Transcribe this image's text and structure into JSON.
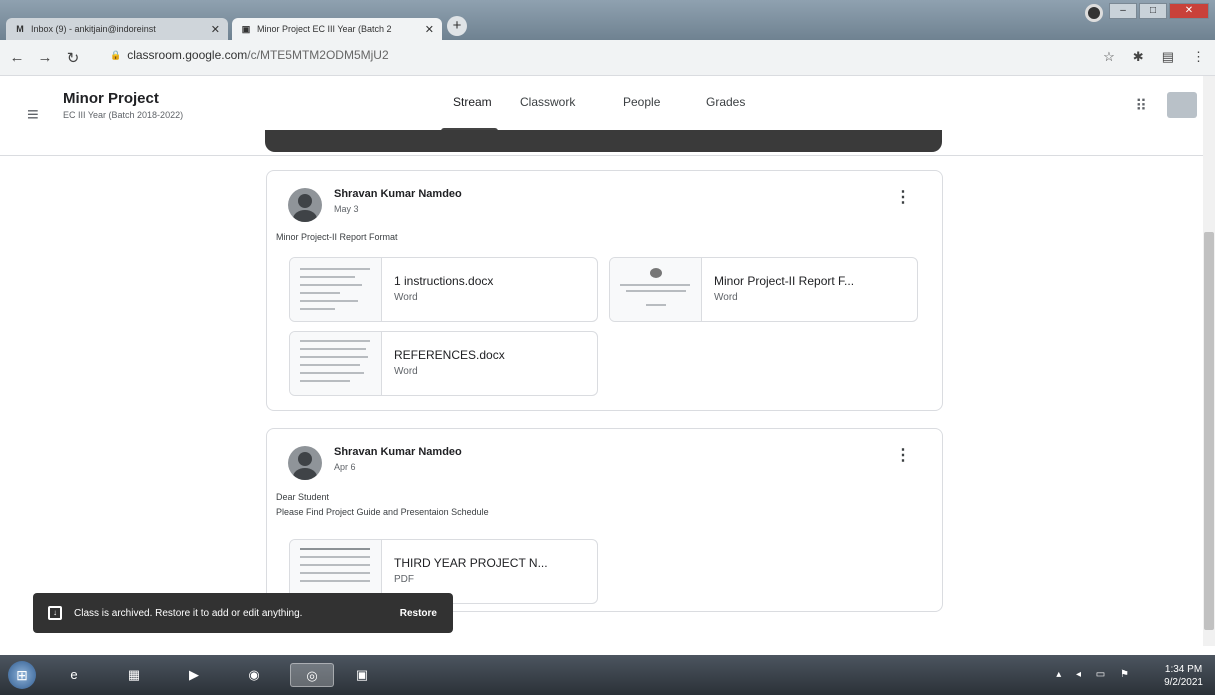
{
  "browser": {
    "tabs": [
      {
        "icon": "M",
        "title": "Inbox (9) - ankitjain@indoreinst",
        "active": false
      },
      {
        "icon": "▣",
        "title": "Minor Project EC III Year (Batch 2",
        "active": true
      }
    ],
    "new_tab_label": "+",
    "url_host": "classroom.google.com",
    "url_path": "/c/MTE5MTM2ODM5MjU2"
  },
  "header": {
    "menu_icon": "hamburger-icon",
    "class_title": "Minor Project",
    "class_subtitle": "EC III Year (Batch 2018-2022)",
    "nav_tabs": [
      {
        "label": "Stream",
        "active": true
      },
      {
        "label": "Classwork",
        "active": false
      },
      {
        "label": "People",
        "active": false
      },
      {
        "label": "Grades",
        "active": false
      }
    ]
  },
  "posts": [
    {
      "author": "Shravan Kumar Namdeo",
      "date": "May 3",
      "body": [
        "Minor Project-II Report Format"
      ],
      "attachments": [
        {
          "name": "1 instructions.docx",
          "type": "Word"
        },
        {
          "name": "Minor Project-II Report F...",
          "type": "Word"
        },
        {
          "name": "REFERENCES.docx",
          "type": "Word"
        }
      ]
    },
    {
      "author": "Shravan Kumar Namdeo",
      "date": "Apr 6",
      "body": [
        "Dear Student",
        "Please Find Project Guide and Presentaion Schedule"
      ],
      "attachments": [
        {
          "name": "THIRD YEAR PROJECT N...",
          "type": "PDF"
        }
      ]
    }
  ],
  "snackbar": {
    "message": "Class is archived. Restore it to add or edit anything.",
    "action": "Restore"
  },
  "taskbar": {
    "time": "1:34 PM",
    "date": "9/2/2021"
  }
}
